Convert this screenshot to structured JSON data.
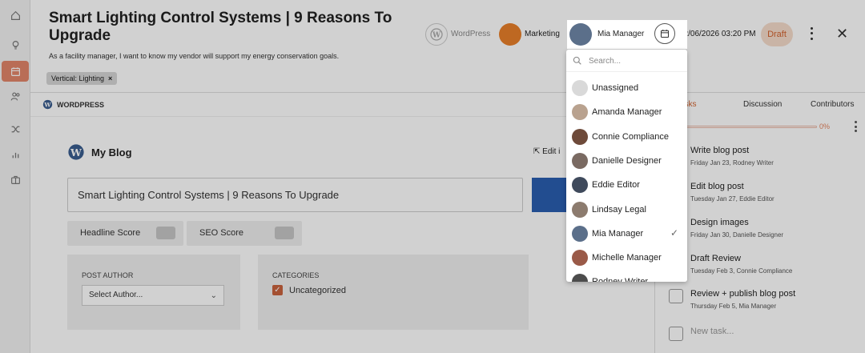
{
  "header": {
    "title": "Smart Lighting Control Systems | 9 Reasons To Upgrade",
    "subtitle": "As a facility manager, I want to know my vendor will support my energy conservation goals.",
    "tag": "Vertical: Lighting",
    "tag_remove": "×",
    "channel": "WordPress",
    "campaign": "Marketing",
    "owner": "Mia Manager",
    "datetime": "02/06/2026 03:20 PM",
    "status": "Draft",
    "close": "✕"
  },
  "sidebar": {
    "items": [
      {
        "icon": "home-icon"
      },
      {
        "icon": "lightbulb-icon"
      },
      {
        "icon": "calendar-icon",
        "active": true
      },
      {
        "icon": "users-icon"
      },
      {
        "icon": "shuffle-icon"
      },
      {
        "icon": "bar-chart-icon"
      },
      {
        "icon": "briefcase-icon"
      }
    ]
  },
  "editor": {
    "section_label": "WORDPRESS",
    "blog_name": "My Blog",
    "edit_link": "Edit i",
    "post_title": "Smart Lighting Control Systems | 9 Reasons To Upgrade",
    "headline_score": "Headline Score",
    "seo_score": "SEO Score",
    "post_author_label": "POST AUTHOR",
    "author_select": "Select Author...",
    "categories_label": "CATEGORIES",
    "category": "Uncategorized"
  },
  "right_panel": {
    "tabs": [
      "asks",
      "Discussion",
      "Contributors"
    ],
    "progress_percent": 0,
    "progress_label": "0%",
    "tasks": [
      {
        "name": "Write blog post",
        "date": "Friday Jan 23,",
        "assignee": "Rodney Writer"
      },
      {
        "name": "Edit blog post",
        "date": "Tuesday Jan 27,",
        "assignee": "Eddie Editor"
      },
      {
        "name": "Design images",
        "date": "Friday Jan 30,",
        "assignee": "Danielle Designer"
      },
      {
        "name": "Draft Review",
        "date": "Tuesday Feb 3,",
        "assignee": "Connie Compliance"
      },
      {
        "name": "Review + publish blog post",
        "date": "Thursday Feb 5,",
        "assignee": "Mia Manager"
      }
    ],
    "new_task_placeholder": "New task..."
  },
  "dropdown": {
    "search_placeholder": "Search...",
    "items": [
      {
        "label": "Unassigned",
        "color": "#d9d9d9",
        "selected": false
      },
      {
        "label": "Amanda Manager",
        "color": "#b9a28f",
        "selected": false
      },
      {
        "label": "Connie Compliance",
        "color": "#6e4a3a",
        "selected": false
      },
      {
        "label": "Danielle Designer",
        "color": "#7a6a62",
        "selected": false
      },
      {
        "label": "Eddie Editor",
        "color": "#3f4a5c",
        "selected": false
      },
      {
        "label": "Lindsay Legal",
        "color": "#8c7b6e",
        "selected": false
      },
      {
        "label": "Mia Manager",
        "color": "#5b6f8a",
        "selected": true
      },
      {
        "label": "Michelle Manager",
        "color": "#9a5a48",
        "selected": false
      },
      {
        "label": "Rodney Writer",
        "color": "#4c4c4c",
        "selected": false
      }
    ]
  },
  "colors": {
    "accent": "#e2866a",
    "draft_bg": "#f6dccb",
    "draft_text": "#d2622e",
    "marketing": "#e87f2a"
  }
}
